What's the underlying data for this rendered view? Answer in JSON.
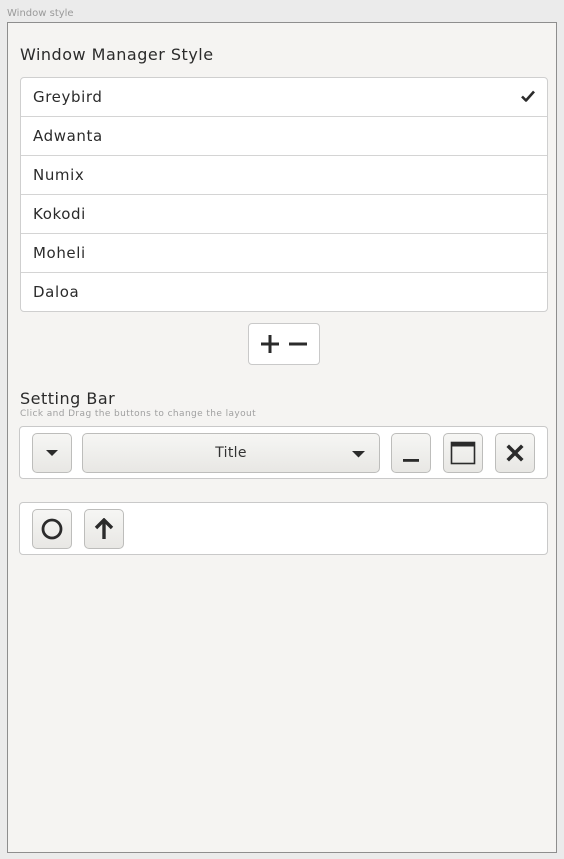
{
  "window": {
    "caption": "Window style"
  },
  "wm_style": {
    "title": "Window Manager Style",
    "items": [
      {
        "label": "Greybird",
        "selected": true
      },
      {
        "label": "Adwanta",
        "selected": false
      },
      {
        "label": "Numix",
        "selected": false
      },
      {
        "label": "Kokodi",
        "selected": false
      },
      {
        "label": "Moheli",
        "selected": false
      },
      {
        "label": "Daloa",
        "selected": false
      }
    ],
    "add_icon": "plus-icon",
    "remove_icon": "minus-icon"
  },
  "setting_bar": {
    "title": "Setting Bar",
    "subtitle": "Click and Drag the buttons to change the layout",
    "active_buttons": {
      "menu_icon": "caret-down-icon",
      "title_label": "Title",
      "title_dropdown_icon": "caret-down-icon",
      "minimize_icon": "minimize-icon",
      "maximize_icon": "maximize-icon",
      "close_icon": "close-icon"
    },
    "hidden_buttons": {
      "stick_icon": "circle-icon",
      "shade_icon": "arrow-up-icon"
    }
  },
  "colors": {
    "background": "#f5f4f2",
    "list_background": "#ffffff",
    "border": "#c9c9c9",
    "text": "#2b2b2b"
  }
}
